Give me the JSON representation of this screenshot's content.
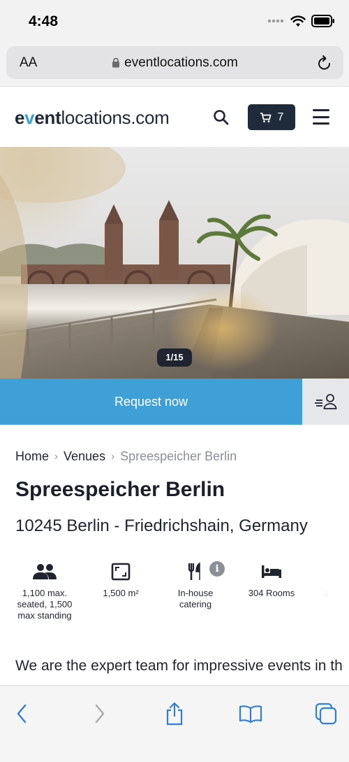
{
  "status_bar": {
    "time": "4:48"
  },
  "browser": {
    "text_size_label": "AA",
    "url": "eventlocations.com"
  },
  "header": {
    "logo_parts": [
      "e",
      "v",
      "ent",
      "locations.com"
    ],
    "cart_count": "7"
  },
  "gallery": {
    "counter": "1/15"
  },
  "actions": {
    "request_label": "Request now"
  },
  "breadcrumb": {
    "items": [
      "Home",
      "Venues",
      "Spreespeicher Berlin"
    ]
  },
  "venue": {
    "title": "Spreespeicher Berlin",
    "location": "10245 Berlin - Friedrichshain, Germany",
    "features": [
      {
        "icon": "people-icon",
        "label": "1,100 max. seated, 1,500 max standing"
      },
      {
        "icon": "area-icon",
        "label": "1,500 m²"
      },
      {
        "icon": "catering-icon",
        "label": "In-house catering",
        "info": "i"
      },
      {
        "icon": "bed-icon",
        "label": "304 Rooms"
      },
      {
        "icon": "partial-icon",
        "label": "u"
      }
    ],
    "description": "We are the expert team for impressive events in the historic granary at the Eastern Harbour"
  },
  "colors": {
    "accent": "#3ea0d7",
    "dark": "#1f2a3a",
    "muted": "#8a8f99"
  }
}
